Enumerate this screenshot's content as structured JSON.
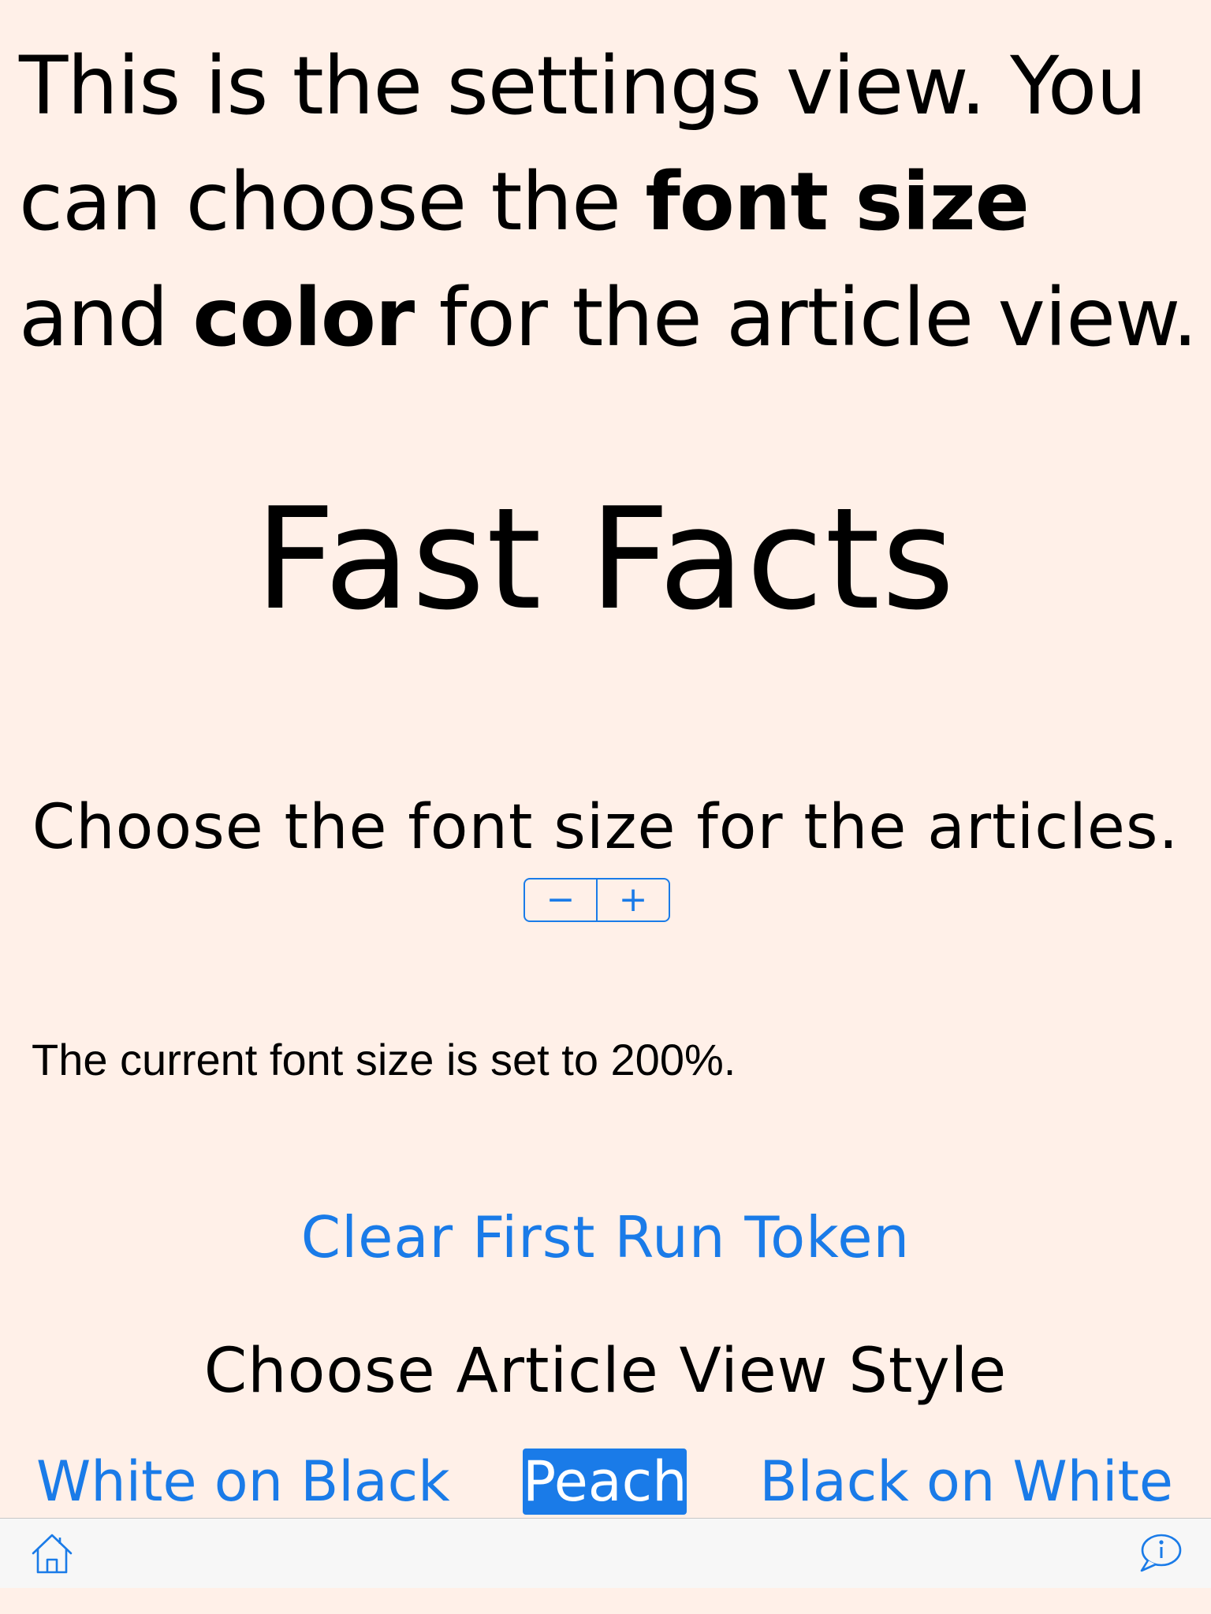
{
  "intro": {
    "part1": "This is the settings view. You can choose the ",
    "bold1": "font size",
    "part2": " and ",
    "bold2": "color",
    "part3": " for the article view."
  },
  "app_title": "Fast Facts",
  "font_size": {
    "prompt": "Choose the font size for the articles.",
    "decrement_symbol": "−",
    "increment_symbol": "+",
    "current_text": "The current font size is set to 200%."
  },
  "clear_token_label": "Clear First Run Token",
  "style_heading": "Choose Article View Style",
  "styles": {
    "options": [
      "White on Black",
      "Peach",
      "Black on White"
    ],
    "selected": "Peach"
  },
  "toolbar": {
    "left_icon": "home-icon",
    "right_icon": "info-bubble-icon"
  },
  "colors": {
    "background": "#fff0e8",
    "accent": "#1a7be8",
    "toolbar_bg": "#f7f7f7"
  }
}
